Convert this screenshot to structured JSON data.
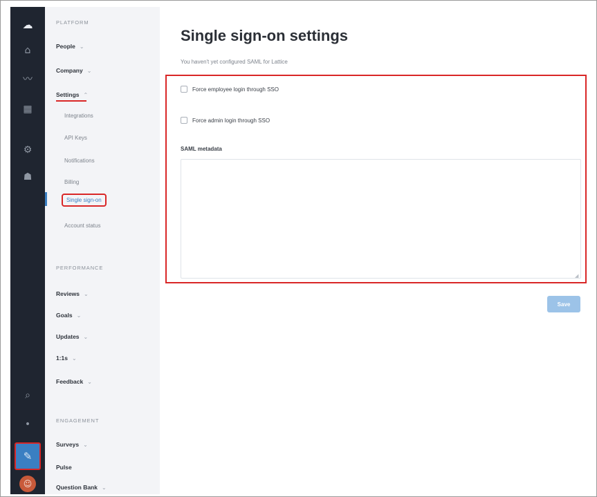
{
  "rail": {
    "icons": [
      "cloud-icon",
      "org-icon",
      "trend-icon",
      "grid-icon",
      "gear-icon",
      "person-icon",
      "search-icon",
      "pin-icon",
      "apps-icon",
      "avatar"
    ],
    "active_icon": "apps-icon"
  },
  "sidebar": {
    "platform_heading": "PLATFORM",
    "people": "People",
    "company": "Company",
    "settings": "Settings",
    "settings_subitems": [
      "Integrations",
      "API Keys",
      "Notifications",
      "Billing",
      "Single sign-on",
      "Account status"
    ],
    "performance_heading": "PERFORMANCE",
    "reviews": "Reviews",
    "goals": "Goals",
    "updates": "Updates",
    "one_on_ones": "1:1s",
    "feedback": "Feedback",
    "engagement_heading": "ENGAGEMENT",
    "surveys": "Surveys",
    "pulse": "Pulse",
    "question_bank": "Question Bank"
  },
  "main": {
    "title": "Single sign-on settings",
    "subtitle": "You haven't yet configured SAML for Lattice",
    "force_employee_label": "Force employee login through SSO",
    "force_admin_label": "Force admin login through SSO",
    "saml_label": "SAML metadata",
    "saml_value": "",
    "save_label": "Save"
  },
  "colors": {
    "rail_bg": "#1f2530",
    "sidebar_bg": "#f3f4f7",
    "accent": "#3a7fc2",
    "annotation_red": "#d92626",
    "button_disabled": "#9cc3e8"
  }
}
